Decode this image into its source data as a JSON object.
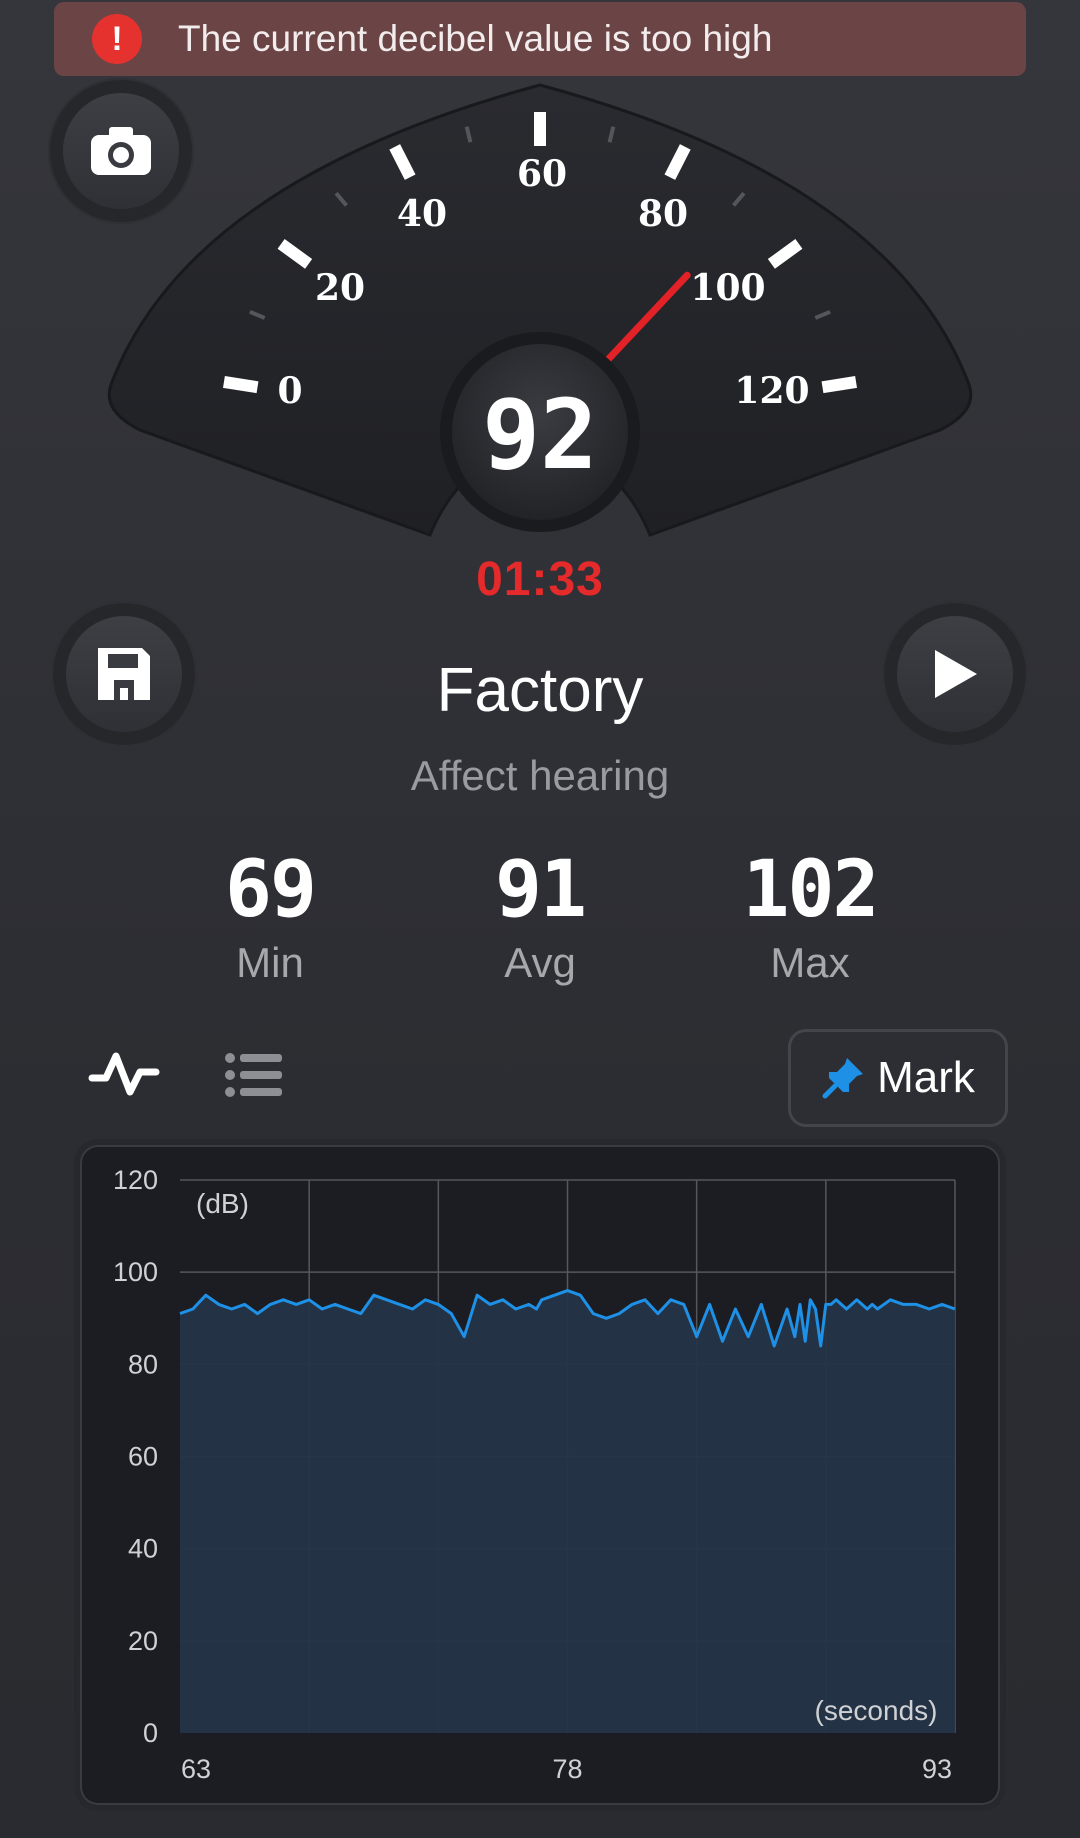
{
  "alert": {
    "icon": "exclamation-icon",
    "glyph": "!",
    "text": "The current decibel value is too high"
  },
  "gauge": {
    "scale_labels": [
      "0",
      "20",
      "40",
      "60",
      "80",
      "100",
      "120"
    ],
    "current_value": "92",
    "needle_db": 92,
    "needle_color": "#e32227"
  },
  "timer": "01:33",
  "scene": {
    "title": "Factory",
    "subtitle": "Affect hearing"
  },
  "stats": [
    {
      "value": "69",
      "label": "Min"
    },
    {
      "value": "91",
      "label": "Avg"
    },
    {
      "value": "102",
      "label": "Max"
    }
  ],
  "buttons": {
    "camera": "camera-icon",
    "save": "save-icon",
    "play": "play-icon",
    "mark_label": "Mark",
    "mark_icon": "pin-icon"
  },
  "tabs": [
    {
      "icon": "waveform-icon"
    },
    {
      "icon": "list-icon"
    }
  ],
  "chart_data": {
    "type": "area",
    "y_unit_label": "(dB)",
    "x_unit_label": "(seconds)",
    "ylim": [
      0,
      120
    ],
    "yticks": [
      "0",
      "20",
      "40",
      "60",
      "80",
      "100",
      "120"
    ],
    "xlim": [
      63,
      93
    ],
    "xticks": [
      "63",
      "78",
      "93"
    ],
    "grid": true,
    "line_color": "#1e90e6",
    "fill_color": "#243447",
    "series": [
      {
        "x": [
          63,
          63.5,
          64,
          64.5,
          65,
          65.5,
          66,
          66.5,
          67,
          67.5,
          68,
          68.5,
          69,
          69.5,
          70,
          70.5,
          71,
          71.5,
          72,
          72.5,
          73,
          73.5,
          74,
          74.5,
          75,
          75.5,
          76,
          76.5,
          76.8,
          77,
          77.5,
          78,
          78.5,
          79,
          79.5,
          80,
          80.5,
          81,
          81.5,
          82,
          82.5,
          83,
          83.5,
          84,
          84.5,
          85,
          85.5,
          86,
          86.5,
          86.8,
          87,
          87.2,
          87.4,
          87.6,
          87.8,
          88,
          88.2,
          88.4,
          88.6,
          88.8,
          89,
          89.2,
          89.4,
          89.6,
          89.8,
          90,
          90.5,
          91,
          91.5,
          92,
          92.5,
          93
        ],
        "y": [
          91,
          92,
          95,
          93,
          92,
          93,
          91,
          93,
          94,
          93,
          94,
          92,
          93,
          92,
          91,
          95,
          94,
          93,
          92,
          94,
          93,
          91,
          86,
          95,
          93,
          94,
          92,
          93,
          92,
          94,
          95,
          96,
          95,
          91,
          90,
          91,
          93,
          94,
          91,
          94,
          93,
          86,
          93,
          85,
          92,
          86,
          93,
          84,
          92,
          86,
          93,
          85,
          94,
          92,
          84,
          93,
          93,
          94,
          93,
          92,
          93,
          94,
          93,
          92,
          93,
          92,
          94,
          93,
          93,
          92,
          93,
          92
        ]
      }
    ]
  }
}
